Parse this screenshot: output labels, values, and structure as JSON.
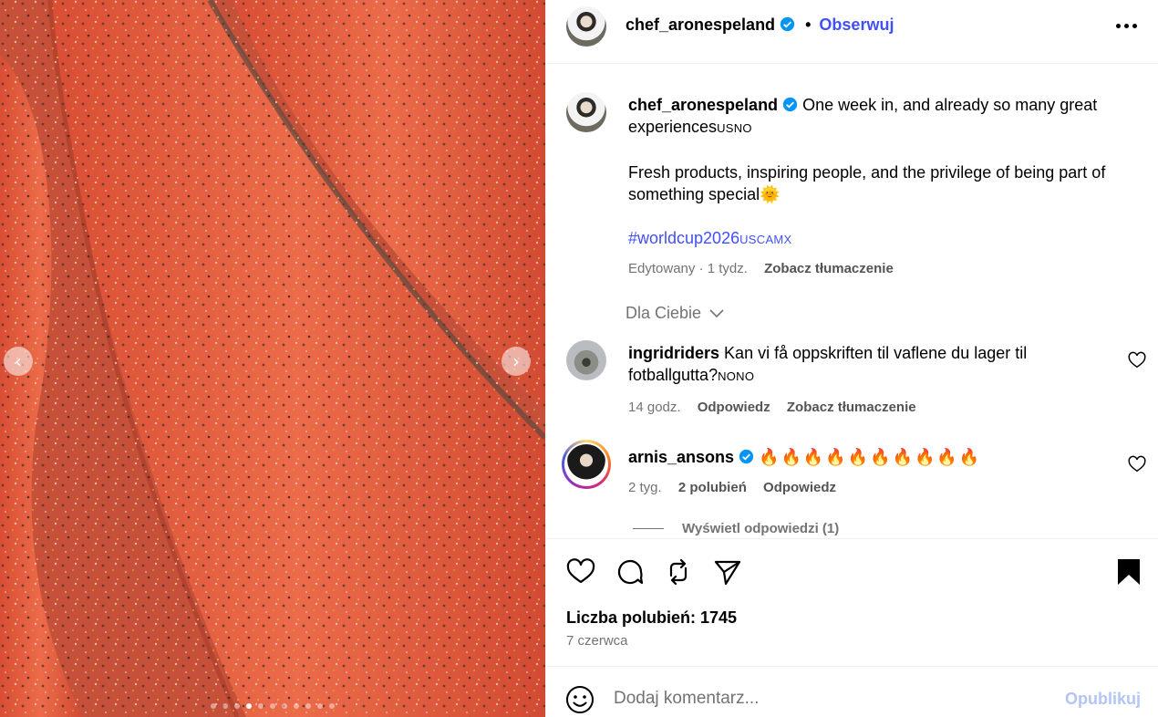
{
  "colors": {
    "accent": "#4150f7",
    "muted": "#737373",
    "publish_disabled": "#b3c4f5",
    "salmon": "#e0553a",
    "verified": "#0095f6"
  },
  "media": {
    "image_description_icon": "salmon-fillets-photo",
    "prev_icon": "chevron-left-icon",
    "next_icon": "chevron-right-icon",
    "carousel_count": 11,
    "carousel_active_index": 3
  },
  "post": {
    "author": "chef_aronespeland",
    "follow_label": "Obserwuj",
    "caption": {
      "line1_text": "One week in, and already so many great experiences",
      "line1_flags": "USNO",
      "line2_text": "Fresh products, inspiring people, and the privilege of being part of something special",
      "line2_emoji": "🌞",
      "hashtag": "#worldcup2026",
      "hashtag_flags": "USCAMX",
      "edited": "Edytowany",
      "time": "1 tydz.",
      "translate": "Zobacz tłumaczenie"
    },
    "for_you_label": "Dla Ciebie",
    "comments": [
      {
        "user": "ingridriders",
        "text": "Kan vi få oppskriften til vaflene du lager til fotballgutta?",
        "flags": "NONO",
        "time": "14 godz.",
        "reply": "Odpowiedz",
        "translate": "Zobacz tłumaczenie"
      },
      {
        "user": "arnis_ansons",
        "text": "🔥🔥🔥🔥🔥🔥🔥🔥🔥🔥",
        "time": "2 tyg.",
        "likes": "2 polubień",
        "reply": "Odpowiedz",
        "view_replies": "Wyświetl odpowiedzi (1)"
      }
    ],
    "likes": "Liczba polubień: 1745",
    "date": "7 czerwca",
    "comment_placeholder": "Dodaj komentarz...",
    "publish_label": "Opublikuj"
  }
}
